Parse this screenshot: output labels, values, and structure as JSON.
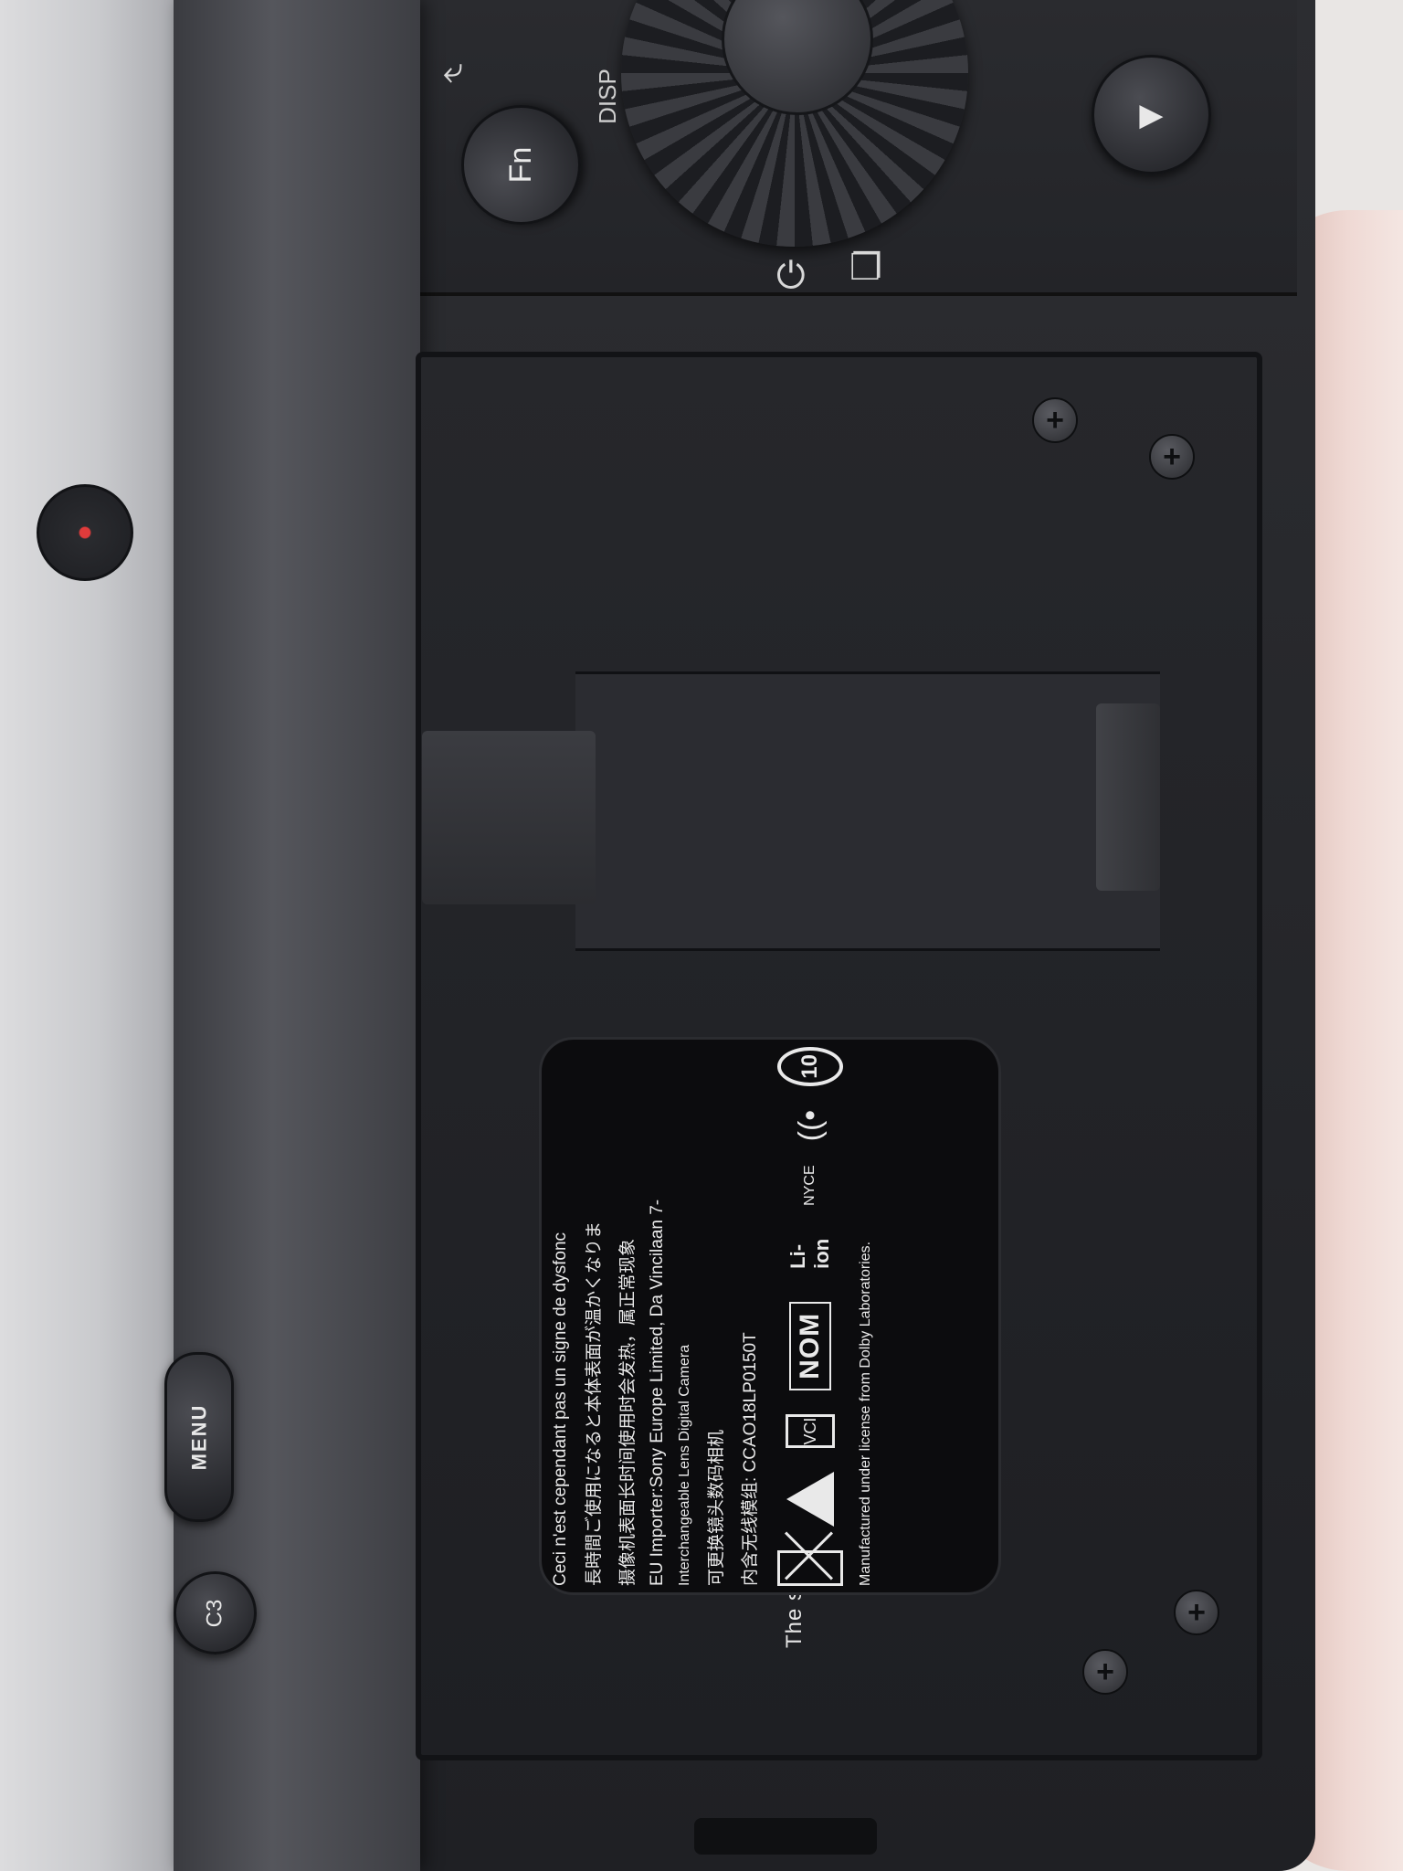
{
  "scene": {
    "subject": "camera-battery-compartment-open",
    "colors": {
      "body": "#26272b",
      "label_bg": "#0c0c0e",
      "label_text": "#e9e9e9",
      "record_dot": "#e03b3b"
    }
  },
  "buttons": {
    "fn_label": "Fn",
    "menu_label": "MENU",
    "c3_label": "C3",
    "disp_label": "DISP"
  },
  "icons": {
    "play": "▶",
    "input": "⤶",
    "timer": "⏻",
    "drive": "❐"
  },
  "warning_text": "The surface of the camera may get warm when the",
  "label": {
    "lines": [
      "Ceci n'est cependant pas un signe de dysfonc",
      "長時間ご使用になると本体表面が温かくなりま",
      "摄像机表面长时间使用时会发热，属正常现象",
      "EU Importer:Sony Europe Limited, Da Vincilaan 7-",
      "Interchangeable Lens Digital Camera",
      "可更换镜头数码相机"
    ],
    "code": "CCAO18LP0150T",
    "marks": {
      "liion": "Li-ion",
      "nom": "NOM",
      "ten": "10",
      "nyce": "NYCE",
      "vci": "VCI"
    },
    "dolby": "Manufactured under license from Dolby Laboratories.",
    "cn_radio": "内含无线模组:"
  }
}
